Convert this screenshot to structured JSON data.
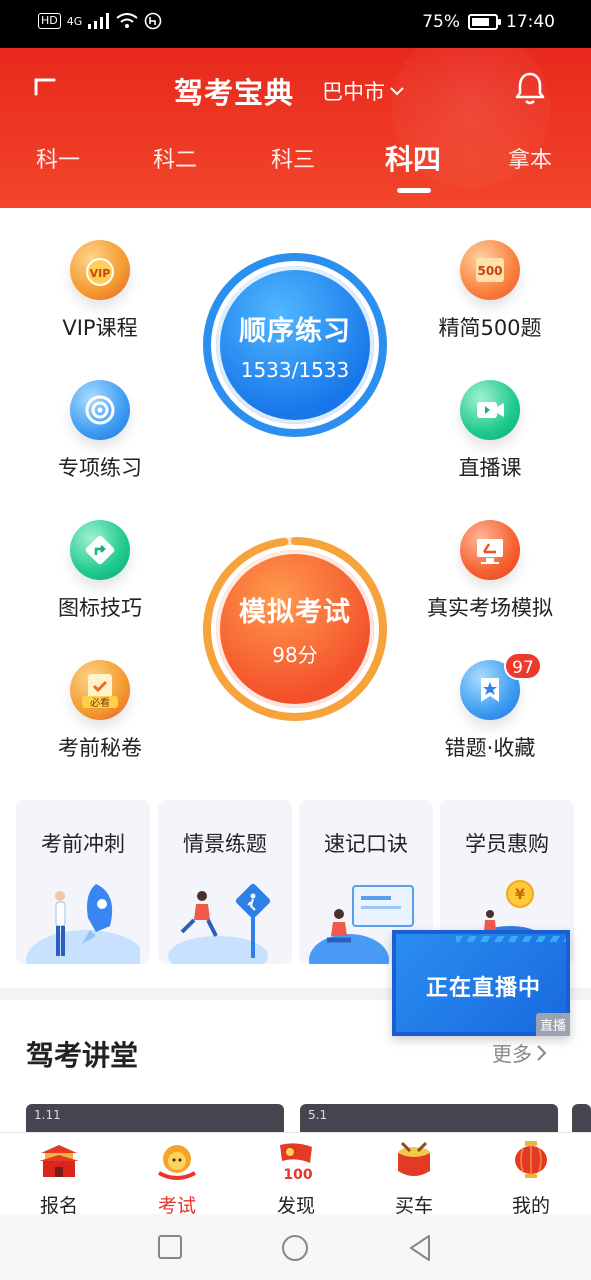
{
  "status_bar": {
    "network_chip": "HD",
    "network_type": "4G",
    "battery": "75%",
    "battery_level": 0.75,
    "time": "17:40"
  },
  "header": {
    "title": "驾考宝典",
    "city": "巴中市",
    "tabs": [
      {
        "label": "科一",
        "active": false
      },
      {
        "label": "科二",
        "active": false
      },
      {
        "label": "科三",
        "active": false
      },
      {
        "label": "科四",
        "active": true
      },
      {
        "label": "拿本",
        "active": false
      }
    ],
    "colors": {
      "primary": "#e8281d",
      "accent_blue": "#1776ea",
      "accent_orange": "#f4502a"
    }
  },
  "features": {
    "left": [
      {
        "label": "VIP课程",
        "icon": "vip-medal-icon"
      },
      {
        "label": "专项练习",
        "icon": "target-icon"
      },
      {
        "label": "图标技巧",
        "icon": "road-sign-icon"
      },
      {
        "label": "考前秘卷",
        "icon": "must-see-clipboard-icon",
        "icon_text": "必看"
      }
    ],
    "right": [
      {
        "label": "精简500题",
        "icon": "500-questions-icon",
        "icon_text": "500"
      },
      {
        "label": "直播课",
        "icon": "video-camera-icon"
      },
      {
        "label": "真实考场模拟",
        "icon": "monitor-icon"
      },
      {
        "label": "错题·收藏",
        "icon": "bookmark-star-icon",
        "badge": "97"
      }
    ]
  },
  "practice": {
    "title": "顺序练习",
    "progress_text": "1533/1533",
    "progress": 1.0
  },
  "mock_exam": {
    "title": "模拟考试",
    "score_text": "98分",
    "score_fraction": 0.98
  },
  "cards": [
    {
      "title": "考前冲刺",
      "illustration": "rocket-illustration"
    },
    {
      "title": "情景练题",
      "illustration": "road-sign-illustration"
    },
    {
      "title": "速记口诀",
      "illustration": "laptop-illustration"
    },
    {
      "title": "学员惠购",
      "illustration": "car-coin-illustration",
      "icon_text": "¥"
    }
  ],
  "lecture": {
    "title": "驾考讲堂",
    "more": "更多",
    "thumbnails": [
      {
        "date": "1.11"
      },
      {
        "date": "5.1"
      }
    ]
  },
  "live_float": {
    "text": "正在直播中",
    "tag": "直播"
  },
  "bottom_nav": [
    {
      "label": "报名",
      "icon": "palace-icon",
      "active": false
    },
    {
      "label": "考试",
      "icon": "lion-mascot-icon",
      "active": true
    },
    {
      "label": "发现",
      "icon": "party-flag-100-icon",
      "active": false,
      "icon_text": "100"
    },
    {
      "label": "买车",
      "icon": "drum-icon",
      "active": false
    },
    {
      "label": "我的",
      "icon": "lantern-icon",
      "active": false
    }
  ]
}
